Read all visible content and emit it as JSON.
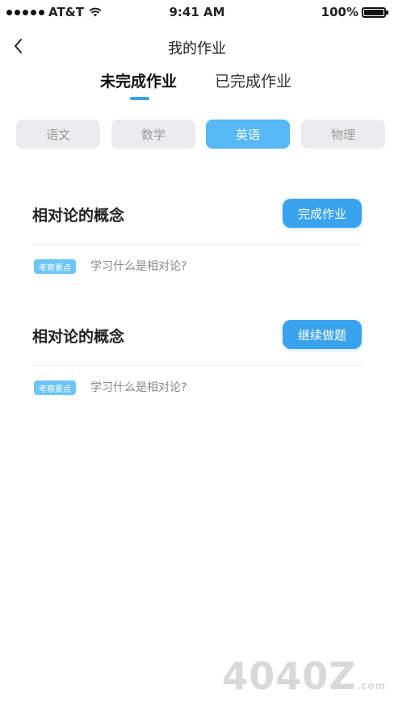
{
  "status_bar": {
    "carrier": "AT&T",
    "time": "9:41 AM",
    "battery_text": "100%",
    "battery_level": 1.0
  },
  "nav": {
    "title": "我的作业",
    "back_icon": "chevron-left-icon"
  },
  "tabs": [
    {
      "label": "未完成作业",
      "active": true
    },
    {
      "label": "已完成作业",
      "active": false
    }
  ],
  "subjects": [
    {
      "label": "语文",
      "selected": false
    },
    {
      "label": "数学",
      "selected": false
    },
    {
      "label": "英语",
      "selected": true
    },
    {
      "label": "物理",
      "selected": false
    }
  ],
  "homework": [
    {
      "title": "相对论的概念",
      "button": "完成作业",
      "tag": "考察要点",
      "description": "学习什么是相对论?"
    },
    {
      "title": "相对论的概念",
      "button": "继续做题",
      "tag": "考察要点",
      "description": "学习什么是相对论?"
    }
  ],
  "watermark": {
    "text": "4040Z",
    "suffix": ".com"
  },
  "colors": {
    "accent": "#3aa3ee",
    "selected_chip": "#56b8f5",
    "chip_bg": "#ececef",
    "tag_bg": "#6cc5f8"
  }
}
